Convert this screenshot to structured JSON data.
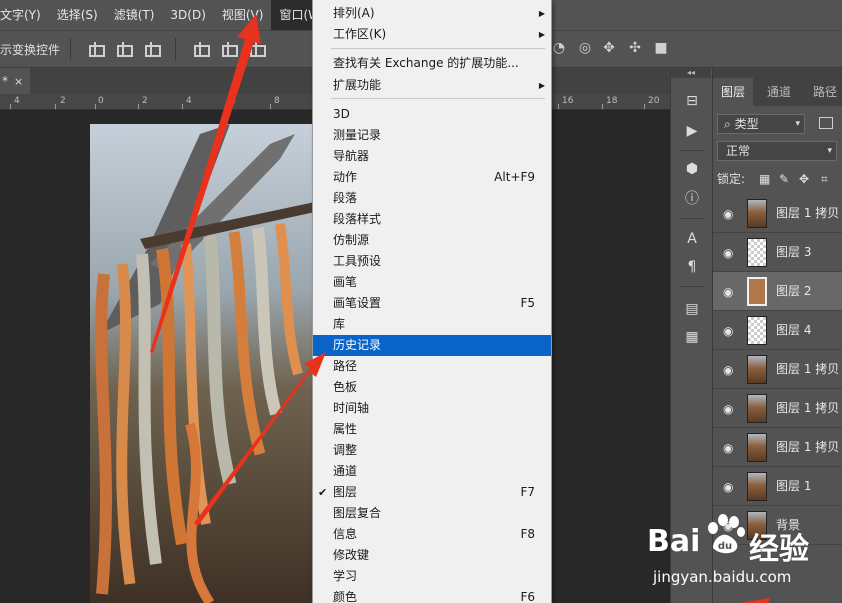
{
  "menubar": {
    "items": [
      "文字(Y)",
      "选择(S)",
      "滤镜(T)",
      "3D(D)",
      "视图(V)",
      "窗口(W)"
    ]
  },
  "options_bar": {
    "label": "示变换控件"
  },
  "document_tab": {
    "title": "*",
    "close": "×"
  },
  "ruler": {
    "ticks": [
      "4",
      "2",
      "0",
      "2",
      "4",
      "6",
      "8",
      "10",
      "12",
      "14",
      "16",
      "18",
      "20"
    ]
  },
  "window_menu": {
    "items": [
      {
        "label": "排列(A)",
        "submenu": true
      },
      {
        "label": "工作区(K)",
        "submenu": true
      },
      {
        "label": "查找有关 Exchange 的扩展功能..."
      },
      {
        "label": "扩展功能",
        "submenu": true
      },
      {
        "label": "3D"
      },
      {
        "label": "测量记录"
      },
      {
        "label": "导航器"
      },
      {
        "label": "动作",
        "shortcut": "Alt+F9"
      },
      {
        "label": "段落"
      },
      {
        "label": "段落样式"
      },
      {
        "label": "仿制源"
      },
      {
        "label": "工具预设"
      },
      {
        "label": "画笔"
      },
      {
        "label": "画笔设置",
        "shortcut": "F5"
      },
      {
        "label": "库"
      },
      {
        "label": "历史记录",
        "highlighted": true
      },
      {
        "label": "路径"
      },
      {
        "label": "色板"
      },
      {
        "label": "时间轴"
      },
      {
        "label": "属性"
      },
      {
        "label": "调整"
      },
      {
        "label": "通道"
      },
      {
        "label": "图层",
        "shortcut": "F7",
        "checked": true
      },
      {
        "label": "图层复合"
      },
      {
        "label": "信息",
        "shortcut": "F8"
      },
      {
        "label": "修改键"
      },
      {
        "label": "学习"
      },
      {
        "label": "颜色",
        "shortcut": "F6"
      }
    ],
    "check_glyph": "✔",
    "arrow_glyph": "▶"
  },
  "layers_panel": {
    "collapse_glyph": "◂◂",
    "tabs": [
      "图层",
      "通道",
      "路径"
    ],
    "filter_label": "类型",
    "filter_icon": "search-icon",
    "blend_mode": "正常",
    "lock_label": "锁定:",
    "layers": [
      {
        "name": "图层 1 拷贝",
        "thumb": "photo"
      },
      {
        "name": "图层 3",
        "thumb": "checker"
      },
      {
        "name": "图层 2",
        "thumb": "fill",
        "selected": true
      },
      {
        "name": "图层 4",
        "thumb": "checker"
      },
      {
        "name": "图层 1 拷贝",
        "thumb": "photo"
      },
      {
        "name": "图层 1 拷贝",
        "thumb": "photo"
      },
      {
        "name": "图层 1 拷贝",
        "thumb": "photo"
      },
      {
        "name": "图层 1",
        "thumb": "photo"
      },
      {
        "name": "背景",
        "thumb": "photo"
      }
    ],
    "eye_glyph": "👁"
  },
  "watermark": {
    "logo_left": "Bai",
    "logo_right": "经验",
    "url": "jingyan.baidu.com"
  },
  "colors": {
    "menu_highlight": "#0a64c8",
    "arrow_red": "#e8321e",
    "app_bg": "#535353",
    "canvas_bg": "#282828"
  }
}
